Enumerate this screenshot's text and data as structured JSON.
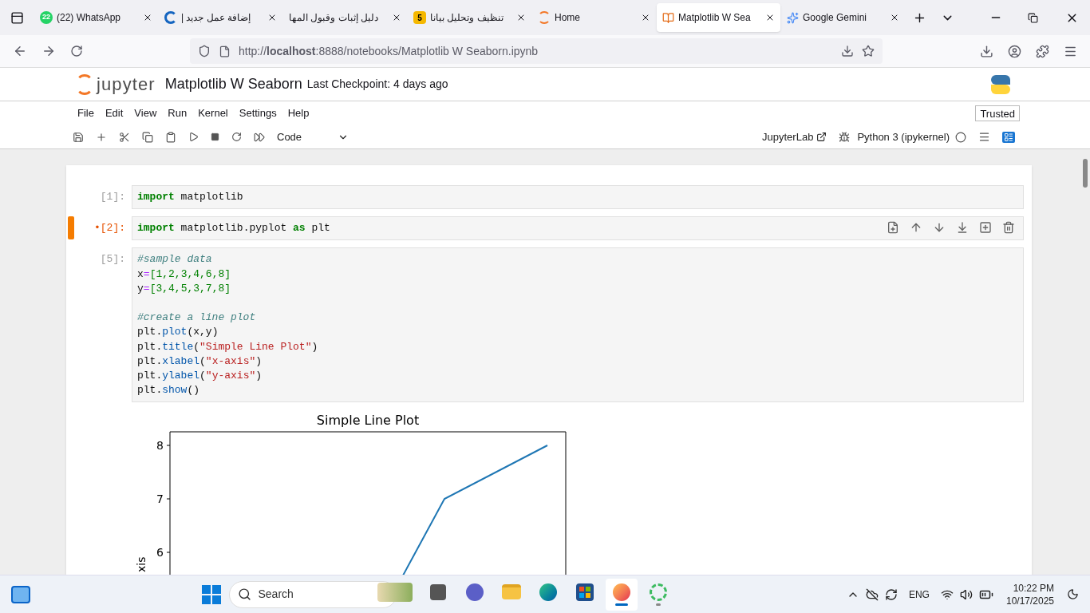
{
  "browser": {
    "tabs": [
      {
        "title": "(22) WhatsApp",
        "kind": "badge",
        "badge": "22",
        "selected": false
      },
      {
        "title": "إضافة عمل جديد |",
        "kind": "ring",
        "selected": false
      },
      {
        "title": "دليل إثبات وقبول المها",
        "kind": "plain",
        "selected": false
      },
      {
        "title": "تنظيف وتحليل بيانا",
        "kind": "square",
        "badge": "5",
        "selected": false
      },
      {
        "title": "Home",
        "kind": "jupyter",
        "selected": false
      },
      {
        "title": "Matplotlib W Sea",
        "kind": "book",
        "selected": true
      },
      {
        "title": "Google Gemini",
        "kind": "sparkle",
        "selected": false
      }
    ],
    "address": "http://**localhost**:8888/notebooks/Matplotlib W Seaborn.ipynb"
  },
  "jupyter": {
    "logo_text": "jupyter",
    "notebook_title": "Matplotlib W Seaborn",
    "checkpoint": "Last Checkpoint: 4 days ago",
    "menu": [
      "File",
      "Edit",
      "View",
      "Run",
      "Kernel",
      "Settings",
      "Help"
    ],
    "trusted": "Trusted",
    "cell_type": "Code",
    "lab_link": "JupyterLab",
    "kernel": "Python 3 (ipykernel)",
    "kernel_busy": false
  },
  "cells": [
    {
      "prompt": "[1]:",
      "active": false,
      "lines": [
        {
          "tokens": [
            {
              "kind": "kw",
              "text": "import"
            },
            {
              "kind": "plain",
              "text": " matplotlib"
            }
          ]
        }
      ]
    },
    {
      "prompt": "•[2]:",
      "active": true,
      "lines": [
        {
          "tokens": [
            {
              "kind": "kw",
              "text": "import"
            },
            {
              "kind": "plain",
              "text": " matplotlib.pyplot "
            },
            {
              "kind": "kw",
              "text": "as"
            },
            {
              "kind": "plain",
              "text": " plt"
            }
          ]
        }
      ]
    },
    {
      "prompt": "[5]:",
      "active": false,
      "lines": [
        {
          "tokens": [
            {
              "kind": "comment",
              "text": "#sample data"
            }
          ]
        },
        {
          "tokens": [
            {
              "kind": "plain",
              "text": "x"
            },
            {
              "kind": "op",
              "text": "="
            },
            {
              "kind": "num",
              "text": "[1,2,3,4,6,8]"
            }
          ]
        },
        {
          "tokens": [
            {
              "kind": "plain",
              "text": "y"
            },
            {
              "kind": "op",
              "text": "="
            },
            {
              "kind": "num",
              "text": "[3,4,5,3,7,8]"
            }
          ]
        },
        {
          "blank": true
        },
        {
          "tokens": [
            {
              "kind": "comment",
              "text": "#create a line plot"
            }
          ]
        },
        {
          "tokens": [
            {
              "kind": "plain",
              "text": "plt."
            },
            {
              "kind": "attr",
              "text": "plot"
            },
            {
              "kind": "plain",
              "text": "(x,y)"
            }
          ]
        },
        {
          "tokens": [
            {
              "kind": "plain",
              "text": "plt."
            },
            {
              "kind": "attr",
              "text": "title"
            },
            {
              "kind": "plain",
              "text": "("
            },
            {
              "kind": "str",
              "text": "\"Simple Line Plot\""
            },
            {
              "kind": "plain",
              "text": ")"
            }
          ]
        },
        {
          "tokens": [
            {
              "kind": "plain",
              "text": "plt."
            },
            {
              "kind": "attr",
              "text": "xlabel"
            },
            {
              "kind": "plain",
              "text": "("
            },
            {
              "kind": "str",
              "text": "\"x-axis\""
            },
            {
              "kind": "plain",
              "text": ")"
            }
          ]
        },
        {
          "tokens": [
            {
              "kind": "plain",
              "text": "plt."
            },
            {
              "kind": "attr",
              "text": "ylabel"
            },
            {
              "kind": "plain",
              "text": "("
            },
            {
              "kind": "str",
              "text": "\"y-axis\""
            },
            {
              "kind": "plain",
              "text": ")"
            }
          ]
        },
        {
          "tokens": [
            {
              "kind": "plain",
              "text": "plt."
            },
            {
              "kind": "attr",
              "text": "show"
            },
            {
              "kind": "plain",
              "text": "()"
            }
          ]
        }
      ]
    }
  ],
  "output": {
    "plot": {
      "title": "Simple Line Plot",
      "yticks": [
        "8",
        "7",
        "6"
      ],
      "ylabel": "xis"
    }
  },
  "taskbar": {
    "search": "Search",
    "apps": [
      {
        "kind": "photo",
        "selected": false,
        "running": false
      },
      {
        "kind": "terminal",
        "selected": false,
        "running": false
      },
      {
        "kind": "copilot",
        "selected": false,
        "running": false
      },
      {
        "kind": "folder",
        "selected": false,
        "running": false
      },
      {
        "kind": "edge",
        "selected": false,
        "running": false
      },
      {
        "kind": "store",
        "selected": false,
        "running": false
      },
      {
        "kind": "firefox",
        "selected": true,
        "running": true
      },
      {
        "kind": "ring",
        "selected": false,
        "running": true
      }
    ],
    "language": "ENG",
    "time": "10:22 PM",
    "date": "10/17/2025"
  }
}
